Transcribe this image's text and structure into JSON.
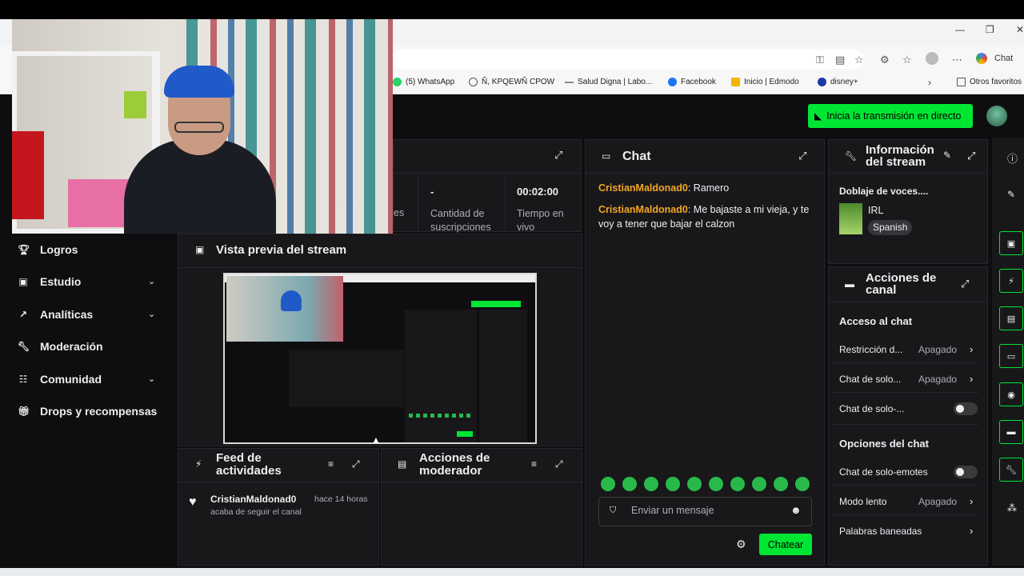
{
  "browser": {
    "copilot_label": "Chat",
    "bookmarks": [
      {
        "label": "(5) WhatsApp",
        "color": "#25d366"
      },
      {
        "label": "Ñ, KPQEWÑ CPOW",
        "color": "#555555"
      },
      {
        "label": "Salud Digna | Labo...",
        "color": "#888888"
      },
      {
        "label": "Facebook",
        "color": "#1877f2"
      },
      {
        "label": "Inicio | Edmodo",
        "color": "#f5b400"
      },
      {
        "label": "disney+",
        "color": "#1a3aa8"
      }
    ],
    "other_favorites": "Otros favoritos"
  },
  "header": {
    "go_live_label": "Inicia la transmisión en directo"
  },
  "sidebar": {
    "items": [
      {
        "label": "Logros",
        "icon": "trophy-icon",
        "has_chevron": false
      },
      {
        "label": "Estudio",
        "icon": "studio-icon",
        "has_chevron": true
      },
      {
        "label": "Analíticas",
        "icon": "analytics-icon",
        "has_chevron": true
      },
      {
        "label": "Moderación",
        "icon": "wrench-icon",
        "has_chevron": false
      },
      {
        "label": "Comunidad",
        "icon": "community-icon",
        "has_chevron": true
      },
      {
        "label": "Drops y recompensas",
        "icon": "gift-icon",
        "has_chevron": false
      }
    ]
  },
  "stats": {
    "partial_label": "es",
    "subs_value": "-",
    "subs_label": "Cantidad de suscripciones",
    "time_value": "00:02:00",
    "time_label": "Tiempo en vivo"
  },
  "preview": {
    "title": "Vista previa del stream"
  },
  "activity": {
    "title": "Feed de actividades",
    "event_user": "CristianMaldonad0",
    "event_time": "hace 14 horas",
    "event_text": "acaba de seguir el canal"
  },
  "mod_actions": {
    "title": "Acciones de moderador"
  },
  "chat": {
    "title": "Chat",
    "messages": [
      {
        "user": "CristianMaldonad0",
        "text": "Ramero"
      },
      {
        "user": "CristianMaldonad0",
        "text": "Me bajaste a mi vieja, y te voy a tener que bajar el calzon"
      }
    ],
    "input_placeholder": "Enviar un mensaje",
    "send_label": "Chatear",
    "user_color": "#f5a623"
  },
  "stream_info": {
    "title": "Información del stream",
    "stream_title": "Doblaje de voces....",
    "category": "IRL",
    "language": "Spanish"
  },
  "channel_actions": {
    "title": "Acciones de canal",
    "section_access": "Acceso al chat",
    "restriction_label": "Restricción d...",
    "restriction_value": "Apagado",
    "solo_chat_label": "Chat de solo...",
    "solo_chat_value": "Apagado",
    "solo_chat2_label": "Chat de solo-...",
    "section_options": "Opciones del chat",
    "emotes_only_label": "Chat de solo-emotes",
    "slow_mode_label": "Modo lento",
    "slow_mode_value": "Apagado",
    "banned_words_label": "Palabras baneadas"
  },
  "colors": {
    "accent": "#00e633",
    "background": "#0e0e10",
    "panel": "#18181b"
  }
}
